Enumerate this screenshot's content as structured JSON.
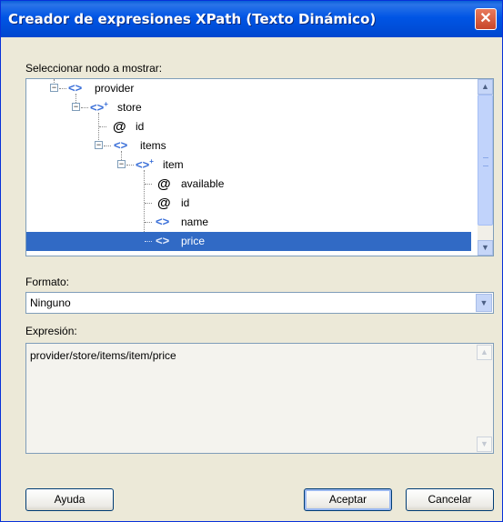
{
  "window": {
    "title": "Creador de expresiones XPath (Texto Dinámico)",
    "close_glyph": "✕"
  },
  "tree": {
    "label": "Seleccionar nodo a mostrar:",
    "nodes": [
      {
        "label": "provider",
        "icon": "element-icon",
        "expanded": true
      },
      {
        "label": "store",
        "icon": "repeating-element-icon",
        "expanded": true
      },
      {
        "label": "id",
        "icon": "attribute-icon"
      },
      {
        "label": "items",
        "icon": "element-icon",
        "expanded": true
      },
      {
        "label": "item",
        "icon": "repeating-element-icon",
        "expanded": true
      },
      {
        "label": "available",
        "icon": "attribute-icon"
      },
      {
        "label": "id",
        "icon": "attribute-icon"
      },
      {
        "label": "name",
        "icon": "element-icon"
      },
      {
        "label": "price",
        "icon": "element-icon",
        "selected": true
      }
    ]
  },
  "format": {
    "label": "Formato:",
    "value": "Ninguno"
  },
  "expression": {
    "label": "Expresión:",
    "value": "provider/store/items/item/price"
  },
  "buttons": {
    "help": "Ayuda",
    "ok": "Aceptar",
    "cancel": "Cancelar"
  },
  "colors": {
    "titlebar": "#0055e5",
    "selection": "#316ac5",
    "dialog_bg": "#ece9d8",
    "close": "#c8462a"
  }
}
